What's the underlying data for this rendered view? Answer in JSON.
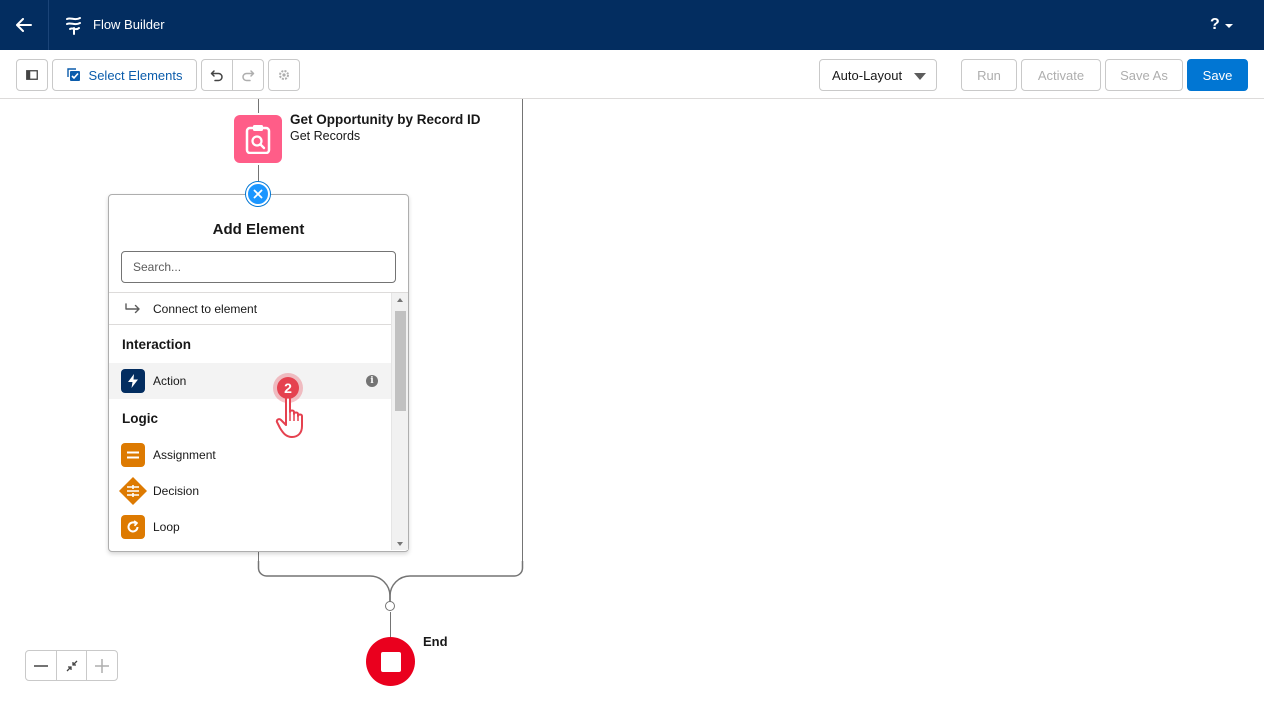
{
  "header": {
    "app_title": "Flow Builder",
    "help_label": "?"
  },
  "toolbar": {
    "select_elements_label": "Select Elements",
    "layout_value": "Auto-Layout",
    "run_label": "Run",
    "activate_label": "Activate",
    "save_as_label": "Save As",
    "save_label": "Save"
  },
  "canvas": {
    "node": {
      "title": "Get Opportunity by Record ID",
      "subtitle": "Get Records",
      "icon": "get-records-icon",
      "color": "#ff5d88"
    },
    "end_label": "End"
  },
  "add_element": {
    "title": "Add Element",
    "search_placeholder": "Search...",
    "connect_label": "Connect to element",
    "sections": [
      {
        "label": "Interaction",
        "items": [
          {
            "label": "Action",
            "icon": "lightning-icon",
            "color": "#032d60"
          }
        ]
      },
      {
        "label": "Logic",
        "items": [
          {
            "label": "Assignment",
            "icon": "equals-icon",
            "color": "#dd7a01"
          },
          {
            "label": "Decision",
            "icon": "decision-icon",
            "color": "#dd7a01"
          },
          {
            "label": "Loop",
            "icon": "loop-icon",
            "color": "#dd7a01"
          }
        ]
      }
    ]
  },
  "step_indicator": "2",
  "colors": {
    "header_bg": "#032d60",
    "brand_blue": "#0176d3",
    "end_red": "#ea001e"
  }
}
